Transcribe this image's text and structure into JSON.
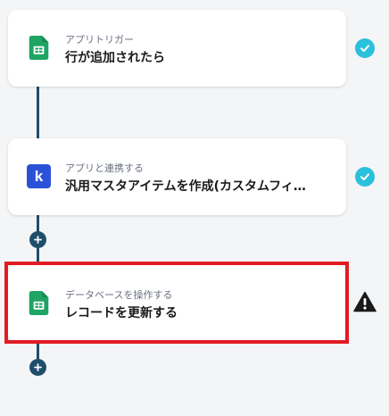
{
  "flow": {
    "steps": [
      {
        "subtitle": "アプリトリガー",
        "title": "行が追加されたら",
        "icon": "google-sheets-icon",
        "status": "completed",
        "status_icon": "check-icon"
      },
      {
        "subtitle": "アプリと連携する",
        "title": "汎用マスタアイテムを作成(カスタムフィ…",
        "icon": "kintone-icon",
        "icon_glyph": "k",
        "status": "completed",
        "status_icon": "check-icon"
      },
      {
        "subtitle": "データベースを操作する",
        "title": "レコードを更新する",
        "icon": "google-sheets-icon",
        "status": "warning",
        "status_icon": "warning-icon",
        "selected": true
      }
    ],
    "add_buttons": [
      {
        "icon": "plus-icon"
      },
      {
        "icon": "plus-icon"
      }
    ]
  },
  "colors": {
    "background": "#f4f5f7",
    "connector": "#1e4e6b",
    "check_badge": "#2bc0dc",
    "selection_border": "#e21b23",
    "sheets_green": "#1fa463",
    "kintone_blue": "#2b52d6",
    "warning": "#1a1a1a"
  }
}
